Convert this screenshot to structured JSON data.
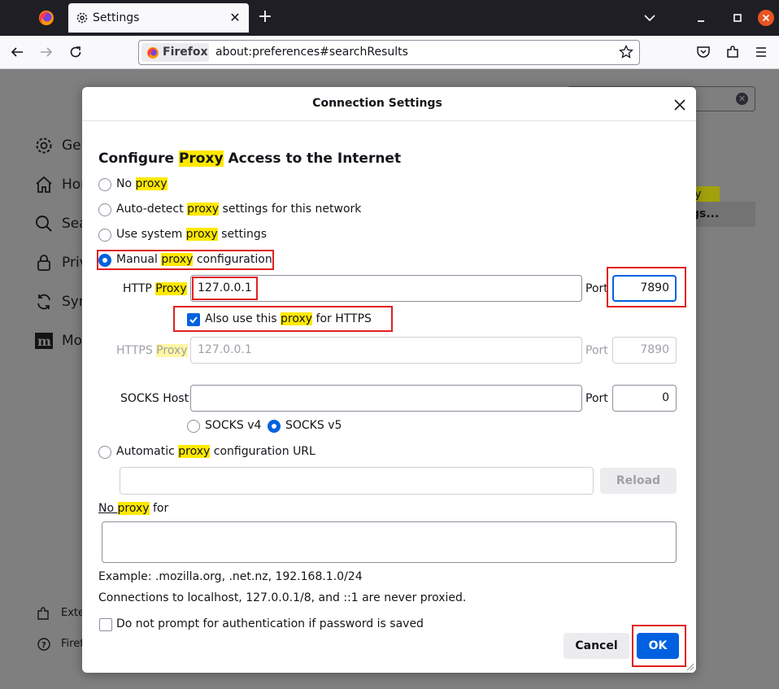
{
  "browser": {
    "tab": {
      "title": "Settings"
    },
    "identity_label": "Firefox",
    "url": "about:preferences#searchResults"
  },
  "page": {
    "sidebar": [
      {
        "label": "Gen",
        "icon": "gear-icon"
      },
      {
        "label": "Hom",
        "icon": "home-icon"
      },
      {
        "label": "Sea",
        "icon": "search-icon"
      },
      {
        "label": "Priv",
        "icon": "lock-icon"
      },
      {
        "label": "Sync",
        "icon": "sync-icon"
      },
      {
        "label": "Mo",
        "icon": "mozilla-icon"
      }
    ],
    "sidebar_bottom": [
      {
        "label": "Exte",
        "icon": "puzzle-icon"
      },
      {
        "label": "Firef",
        "icon": "help-icon"
      }
    ],
    "fragment_highlight": "xy",
    "fragment_button": "ngs..."
  },
  "dialog": {
    "title": "Connection Settings",
    "section": {
      "pre": "Configure ",
      "hl": "Proxy",
      "post": " Access to the Internet"
    },
    "options": {
      "no_proxy": {
        "pre": "No ",
        "hl": "proxy",
        "post": ""
      },
      "auto_detect": {
        "pre": "Auto-detect ",
        "hl": "proxy",
        "post": " settings for this network"
      },
      "system": {
        "pre": "Use system ",
        "hl": "proxy",
        "post": " settings"
      },
      "manual": {
        "pre": "Manual ",
        "hl": "proxy",
        "post": " configuration"
      },
      "auto_url": {
        "pre": "Automatic ",
        "hl": "proxy",
        "post": " configuration URL"
      }
    },
    "http": {
      "pre": "HTTP ",
      "hl": "Proxy",
      "value": "127.0.0.1",
      "port_label": "Port",
      "port": "7890"
    },
    "also_https": {
      "pre": "Also use this ",
      "hl": "proxy",
      "post": " for HTTPS",
      "checked": true
    },
    "https": {
      "pre": "HTTPS ",
      "hl": "Proxy",
      "value": "127.0.0.1",
      "port_label": "Port",
      "port": "7890"
    },
    "socks": {
      "label": "SOCKS Host",
      "value": "",
      "port_label": "Port",
      "port": "0",
      "v4": "SOCKS v4",
      "v5": "SOCKS v5"
    },
    "auto_url_value": "",
    "reload_label": "Reload",
    "no_proxy_for": {
      "pre": "",
      "hl": "proxy",
      "no": "No ",
      "post": " for"
    },
    "no_proxy_value": "",
    "example": "Example: .mozilla.org, .net.nz, 192.168.1.0/24",
    "localhost_note": "Connections to localhost, 127.0.0.1/8, and ::1 are never proxied.",
    "no_prompt": "Do not prompt for authentication if password is saved",
    "cancel_label": "Cancel",
    "ok_label": "OK"
  },
  "colors": {
    "accent": "#0061e0",
    "highlight": "#ffe900",
    "annotation": "#e02020"
  }
}
